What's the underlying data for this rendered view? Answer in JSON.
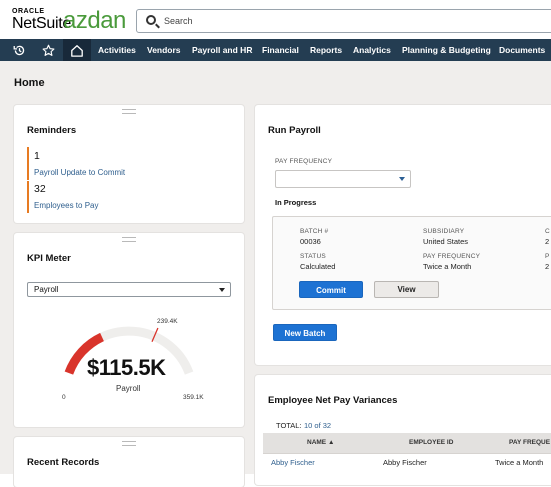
{
  "header": {
    "brand_oracle": "ORACLE",
    "brand_netsuite": "NetSuite",
    "brand_customer": "azdan",
    "search_placeholder": "Search"
  },
  "nav": {
    "icons": [
      "history-icon",
      "star-icon",
      "home-icon"
    ],
    "items": [
      "Activities",
      "Vendors",
      "Payroll and HR",
      "Financial",
      "Reports",
      "Analytics",
      "Planning & Budgeting",
      "Documents"
    ]
  },
  "page": {
    "title": "Home"
  },
  "reminders": {
    "title": "Reminders",
    "items": [
      {
        "count": "1",
        "label": "Payroll Update to Commit"
      },
      {
        "count": "32",
        "label": "Employees to Pay"
      }
    ]
  },
  "kpi_meter": {
    "title": "KPI Meter",
    "selected": "Payroll",
    "value": "$115.5K",
    "value_label": "Payroll",
    "min_label": "0",
    "target_label": "239.4K",
    "max_label": "359.1K",
    "min": 0,
    "max": 359100,
    "current": 115500,
    "target": 239400,
    "accent_color": "#d9342b"
  },
  "run_payroll": {
    "title": "Run Payroll",
    "pay_frequency_label": "PAY FREQUENCY",
    "pay_frequency_value": "",
    "status_heading": "In Progress",
    "batch_label": "BATCH #",
    "batch_value": "00036",
    "subsidiary_label": "SUBSIDIARY",
    "subsidiary_value": "United States",
    "col3_label": "C",
    "col3_value": "2",
    "status_label": "STATUS",
    "status_value": "Calculated",
    "freq_label": "PAY FREQUENCY",
    "freq_value": "Twice a Month",
    "col3b_label": "P",
    "col3b_value": "2",
    "commit_label": "Commit",
    "view_label": "View",
    "new_batch_label": "New Batch"
  },
  "variances": {
    "title": "Employee Net Pay Variances",
    "total_label": "TOTAL:",
    "total_value": "10 of 32",
    "columns": [
      "NAME ▲",
      "EMPLOYEE ID",
      "PAY FREQUE"
    ],
    "rows": [
      [
        "Abby Fischer",
        "Abby Fischer",
        "Twice a Month"
      ]
    ]
  },
  "recent_records": {
    "title": "Recent Records"
  },
  "colors": {
    "nav_bg": "#243d52",
    "brand_green": "#4a9a3b",
    "reminder_accent": "#e77b22",
    "primary_button": "#1d72d3",
    "link": "#2f5f8e"
  }
}
